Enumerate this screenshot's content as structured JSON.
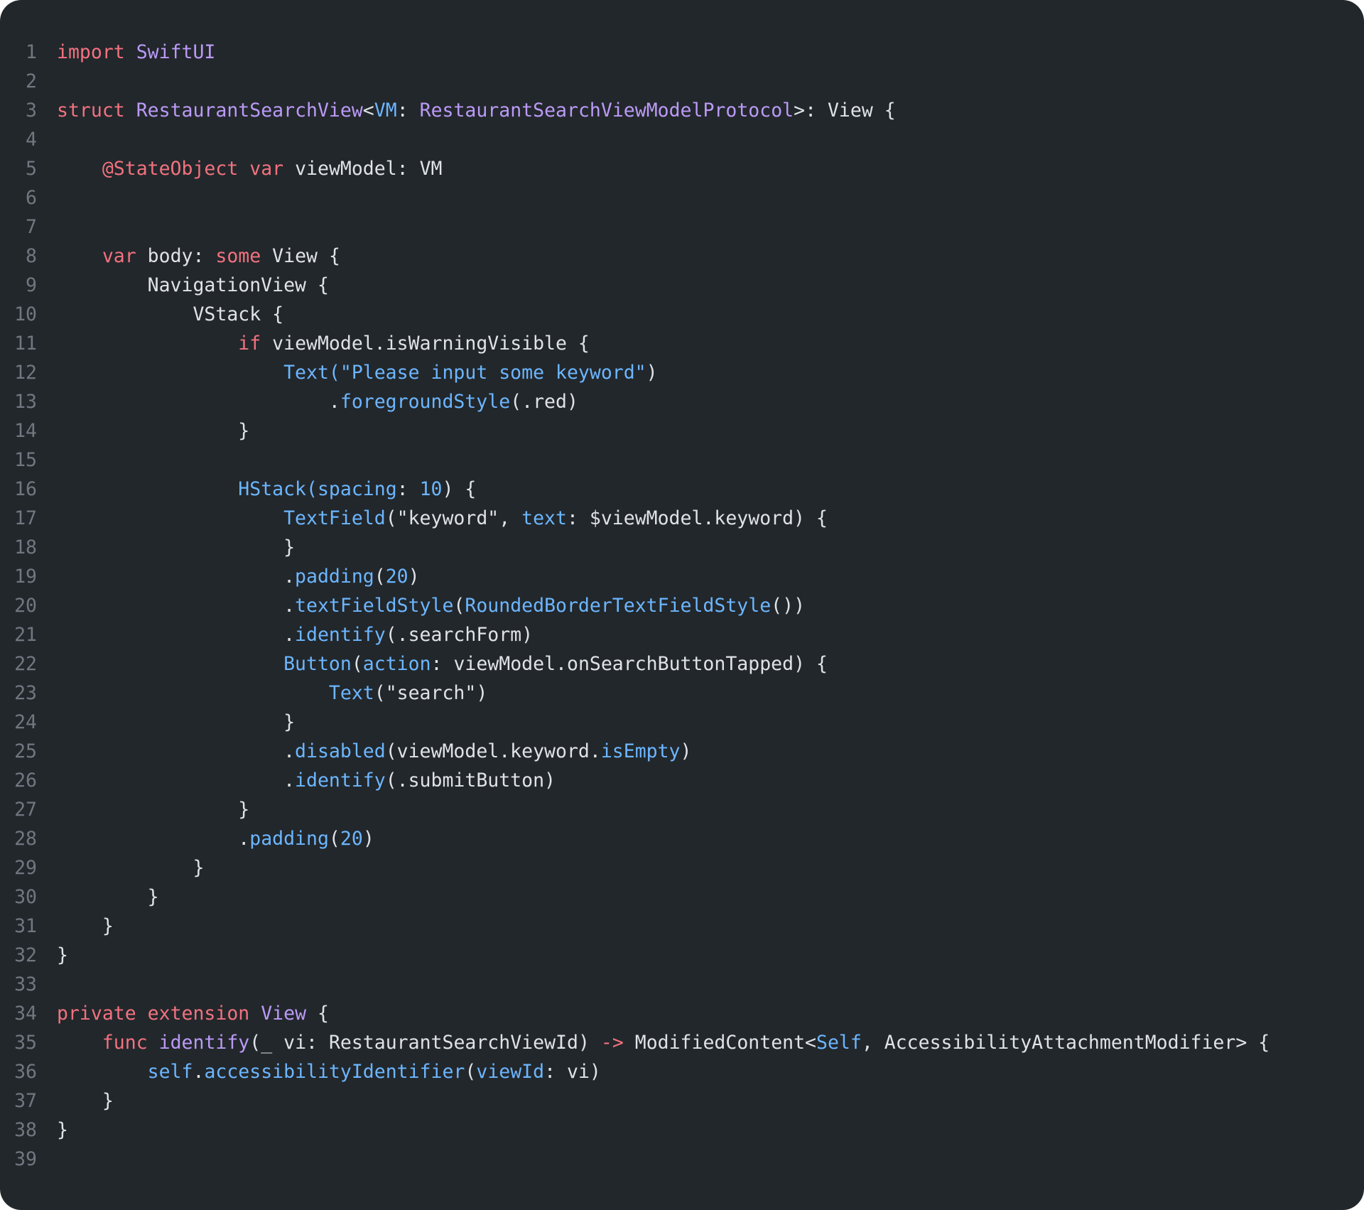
{
  "colors": {
    "background": "#22272b",
    "line_number": "#707780",
    "plain": "#dfe3e8",
    "keyword": "#f2727f",
    "type": "#bb9af7",
    "function": "#6cb6ff"
  },
  "lines": [
    [
      {
        "t": "import",
        "c": "keyword"
      },
      {
        "t": " "
      },
      {
        "t": "SwiftUI",
        "c": "type"
      }
    ],
    [],
    [
      {
        "t": "struct",
        "c": "keyword"
      },
      {
        "t": " "
      },
      {
        "t": "RestaurantSearchView",
        "c": "type"
      },
      {
        "t": "<"
      },
      {
        "t": "VM",
        "c": "function"
      },
      {
        "t": ": "
      },
      {
        "t": "RestaurantSearchViewModelProtocol",
        "c": "type"
      },
      {
        "t": ">: View {"
      }
    ],
    [],
    [
      {
        "t": "    "
      },
      {
        "t": "@StateObject",
        "c": "keyword"
      },
      {
        "t": " "
      },
      {
        "t": "var",
        "c": "keyword"
      },
      {
        "t": " viewModel: VM"
      }
    ],
    [],
    [],
    [
      {
        "t": "    "
      },
      {
        "t": "var",
        "c": "keyword"
      },
      {
        "t": " body: "
      },
      {
        "t": "some",
        "c": "keyword"
      },
      {
        "t": " View {"
      }
    ],
    [
      {
        "t": "        NavigationView {"
      }
    ],
    [
      {
        "t": "            VStack {"
      }
    ],
    [
      {
        "t": "                "
      },
      {
        "t": "if",
        "c": "keyword"
      },
      {
        "t": " viewModel.isWarningVisible {"
      }
    ],
    [
      {
        "t": "                    "
      },
      {
        "t": "Text(\"Please input some keyword\"",
        "c": "function"
      },
      {
        "t": ")"
      }
    ],
    [
      {
        "t": "                        ."
      },
      {
        "t": "foregroundStyle",
        "c": "function"
      },
      {
        "t": "(.red)"
      }
    ],
    [
      {
        "t": "                }"
      }
    ],
    [],
    [
      {
        "t": "                "
      },
      {
        "t": "HStack(spacing",
        "c": "function"
      },
      {
        "t": ": "
      },
      {
        "t": "10",
        "c": "function"
      },
      {
        "t": ") {"
      }
    ],
    [
      {
        "t": "                    "
      },
      {
        "t": "TextField",
        "c": "function"
      },
      {
        "t": "(\"keyword\", "
      },
      {
        "t": "text",
        "c": "function"
      },
      {
        "t": ": $viewModel.keyword) {"
      }
    ],
    [
      {
        "t": "                    }"
      }
    ],
    [
      {
        "t": "                    ."
      },
      {
        "t": "padding",
        "c": "function"
      },
      {
        "t": "("
      },
      {
        "t": "20",
        "c": "function"
      },
      {
        "t": ")"
      }
    ],
    [
      {
        "t": "                    ."
      },
      {
        "t": "textFieldStyle",
        "c": "function"
      },
      {
        "t": "("
      },
      {
        "t": "RoundedBorderTextFieldStyle",
        "c": "function"
      },
      {
        "t": "())"
      }
    ],
    [
      {
        "t": "                    ."
      },
      {
        "t": "identify",
        "c": "function"
      },
      {
        "t": "(.searchForm)"
      }
    ],
    [
      {
        "t": "                    "
      },
      {
        "t": "Button",
        "c": "function"
      },
      {
        "t": "("
      },
      {
        "t": "action",
        "c": "function"
      },
      {
        "t": ": viewModel.onSearchButtonTapped) {"
      }
    ],
    [
      {
        "t": "                        "
      },
      {
        "t": "Text",
        "c": "function"
      },
      {
        "t": "(\"search\")"
      }
    ],
    [
      {
        "t": "                    }"
      }
    ],
    [
      {
        "t": "                    ."
      },
      {
        "t": "disabled",
        "c": "function"
      },
      {
        "t": "(viewModel.keyword."
      },
      {
        "t": "isEmpty",
        "c": "function"
      },
      {
        "t": ")"
      }
    ],
    [
      {
        "t": "                    ."
      },
      {
        "t": "identify",
        "c": "function"
      },
      {
        "t": "(.submitButton)"
      }
    ],
    [
      {
        "t": "                }"
      }
    ],
    [
      {
        "t": "                ."
      },
      {
        "t": "padding",
        "c": "function"
      },
      {
        "t": "("
      },
      {
        "t": "20",
        "c": "function"
      },
      {
        "t": ")"
      }
    ],
    [
      {
        "t": "            }"
      }
    ],
    [
      {
        "t": "        }"
      }
    ],
    [
      {
        "t": "    }"
      }
    ],
    [
      {
        "t": "}"
      }
    ],
    [],
    [
      {
        "t": "private",
        "c": "keyword"
      },
      {
        "t": " "
      },
      {
        "t": "extension",
        "c": "keyword"
      },
      {
        "t": " "
      },
      {
        "t": "View",
        "c": "type"
      },
      {
        "t": " {"
      }
    ],
    [
      {
        "t": "    "
      },
      {
        "t": "func",
        "c": "keyword"
      },
      {
        "t": " "
      },
      {
        "t": "identify",
        "c": "type"
      },
      {
        "t": "(_ vi: RestaurantSearchViewId) "
      },
      {
        "t": "->",
        "c": "keyword"
      },
      {
        "t": " ModifiedContent<"
      },
      {
        "t": "Self",
        "c": "function"
      },
      {
        "t": ", AccessibilityAttachmentModifier> {"
      }
    ],
    [
      {
        "t": "        "
      },
      {
        "t": "self",
        "c": "function"
      },
      {
        "t": "."
      },
      {
        "t": "accessibilityIdentifier",
        "c": "function"
      },
      {
        "t": "("
      },
      {
        "t": "viewId",
        "c": "function"
      },
      {
        "t": ": vi)"
      }
    ],
    [
      {
        "t": "    }"
      }
    ],
    [
      {
        "t": "}"
      }
    ],
    []
  ]
}
